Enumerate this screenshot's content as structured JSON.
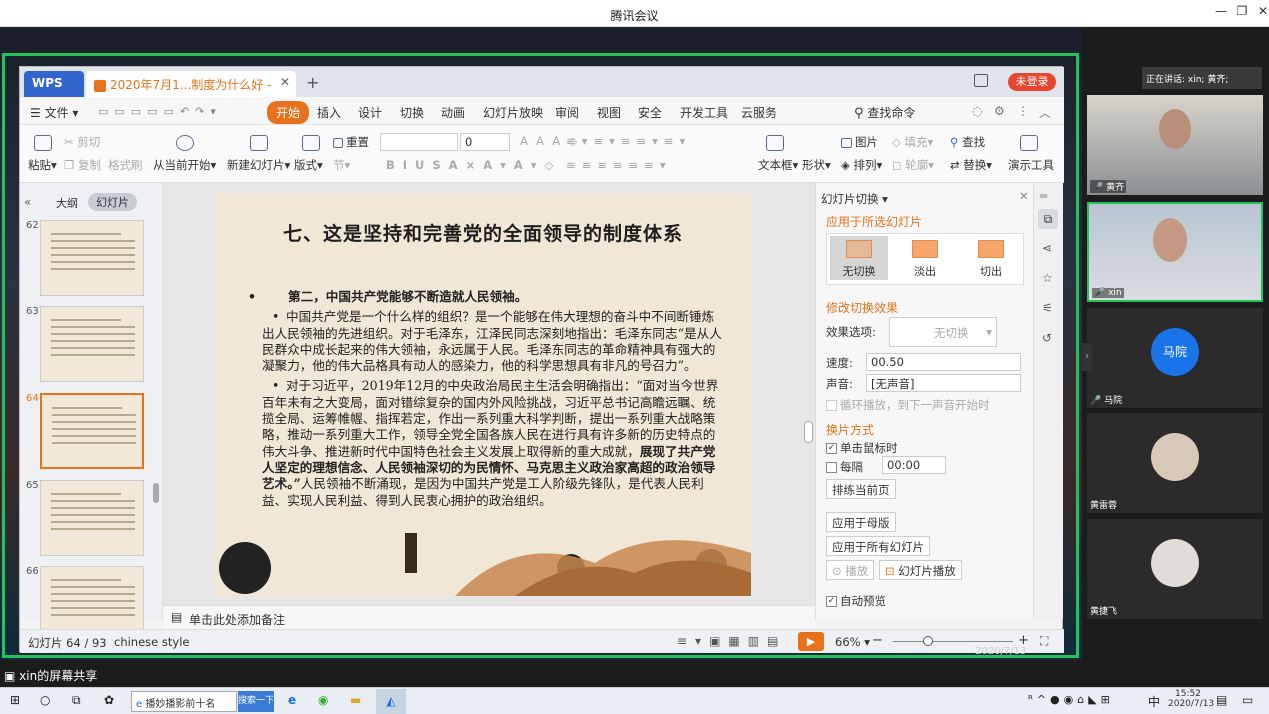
{
  "window": {
    "title": "腾讯会议"
  },
  "wps": {
    "brand": "WPS",
    "doc_tab": "2020年7月1...制度为什么好 -",
    "login": "未登录",
    "menus": [
      "文件",
      "开始",
      "插入",
      "设计",
      "切换",
      "动画",
      "幻灯片放映",
      "审阅",
      "视图",
      "安全",
      "开发工具",
      "云服务"
    ],
    "search_cmd": "查找命令",
    "ribbon": {
      "paste": "粘贴",
      "cut": "剪切",
      "copy": "复制",
      "format_painter": "格式刷",
      "from_current": "从当前开始",
      "new_slide": "新建幻灯片",
      "layout": "版式",
      "reset": "重置",
      "section": "节",
      "font_size": "0",
      "textbox": "文本框",
      "shape": "形状",
      "picture": "图片",
      "arrange": "排列",
      "fill": "填充",
      "outline": "轮廓",
      "find": "查找",
      "replace": "替换",
      "present_tool": "演示工具"
    },
    "left_tabs": {
      "outline": "大纲",
      "slides": "幻灯片"
    },
    "thumbnails": [
      {
        "num": "62",
        "selected": false
      },
      {
        "num": "63",
        "selected": false
      },
      {
        "num": "64",
        "selected": true
      },
      {
        "num": "65",
        "selected": false
      },
      {
        "num": "66",
        "selected": false
      }
    ],
    "slide": {
      "title": "七、这是坚持和完善党的全面领导的制度体系",
      "subhead": "第二，中国共产党能够不断造就人民领袖。",
      "para1": "中国共产党是一个什么样的组织？是一个能够在伟大理想的奋斗中不间断锤炼出人民领袖的先进组织。对于毛泽东，江泽民同志深刻地指出：毛泽东同志“是从人民群众中成长起来的伟大领袖，永远属于人民。毛泽东同志的革命精神具有强大的凝聚力，他的伟大品格具有动人的感染力，他的科学思想具有非凡的号召力”。",
      "para2_normal": "对于习近平，2019年12月的中央政治局民主生活会明确指出：“面对当今世界百年未有之大变局，面对错综复杂的国内外风险挑战，习近平总书记高瞻远瞩、统揽全局、运筹帷幄、指挥若定，作出一系列重大科学判断，提出一系列重大战略策略，推动一系列重大工作，领导全党全国各族人民在进行具有许多新的历史特点的伟大斗争、推进新时代中国特色社会主义发展上取得新的重大成就，",
      "para2_bold": "展现了共产党人坚定的理想信念、人民领袖深切的为民情怀、马克思主义政治家高超的政治领导艺术。”",
      "para2_tail": "人民领袖不断涌现，是因为中国共产党是工人阶级先锋队，是代表人民利益、实现人民利益、得到人民衷心拥护的政治组织。"
    },
    "notes_placeholder": "单击此处添加备注",
    "pane": {
      "title": "幻灯片切换",
      "apply_selected": "应用于所选幻灯片",
      "transitions": [
        "无切换",
        "淡出",
        "切出"
      ],
      "modify_effect": "修改切换效果",
      "effect_options_label": "效果选项:",
      "effect_options_value": "无切换",
      "speed_label": "速度:",
      "speed_value": "00.50",
      "sound_label": "声音:",
      "sound_value": "[无声音]",
      "loop_label": "循环播放，到下一声音开始时",
      "advance_title": "换片方式",
      "on_click": "单击鼠标时",
      "every": "每隔",
      "every_value": "00:00",
      "rehearse": "排练当前页",
      "apply_master": "应用于母版",
      "apply_all": "应用于所有幻灯片",
      "play": "播放",
      "slideshow": "幻灯片播放",
      "auto_preview": "自动预览"
    },
    "status": {
      "slide_count": "幻灯片 64 / 93",
      "theme": "chinese style",
      "zoom": "66%",
      "date": "2020/7/13"
    }
  },
  "participants": {
    "speaking": "正在讲话: xin; 黄齐;",
    "tiles": [
      {
        "name": "黄齐",
        "kind": "video"
      },
      {
        "name": "xin",
        "kind": "video"
      },
      {
        "name": "马院",
        "kind": "avatar",
        "avatar_text": "马院"
      },
      {
        "name": "黄雷蓉",
        "kind": "photo"
      },
      {
        "name": "黄捷飞",
        "kind": "photo"
      }
    ]
  },
  "share_label": "xin的屏幕共享",
  "taskbar": {
    "search_text": "播妙播影前十名",
    "search_button": "搜索一下",
    "time": "15:52",
    "date": "2020/7/13",
    "ime": "中"
  },
  "colors": {
    "accent": "#e8721c",
    "green_frame": "#21c35b",
    "meeting_blue": "#1a73e8"
  }
}
